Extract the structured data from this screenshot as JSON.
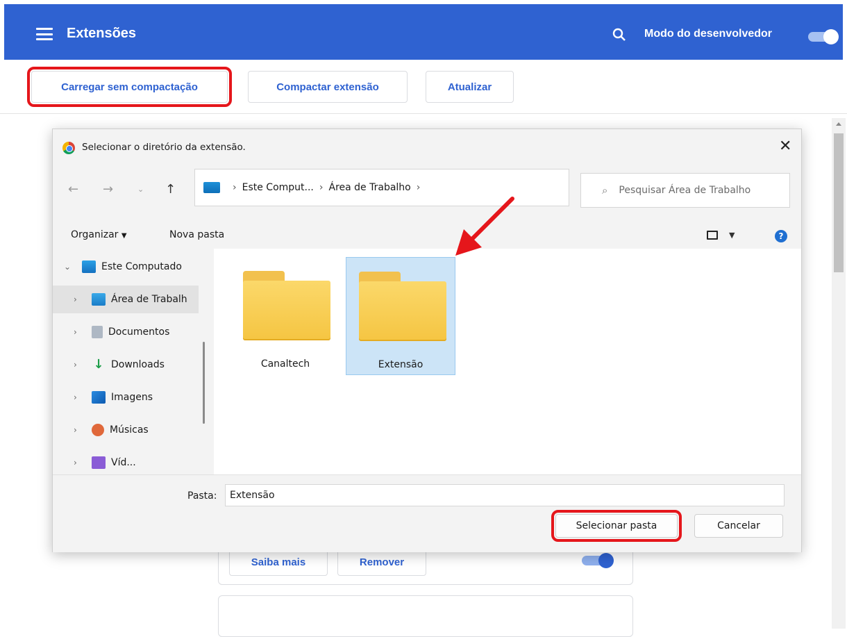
{
  "header": {
    "title": "Extensões",
    "dev_mode_label": "Modo do desenvolvedor",
    "dev_mode_enabled": true
  },
  "toolbar": {
    "load_unpacked": "Carregar sem compactação",
    "pack_extension": "Compactar extensão",
    "update": "Atualizar"
  },
  "background_card": {
    "learn_more": "Saiba mais",
    "remove": "Remover",
    "enabled": true
  },
  "dialog": {
    "title": "Selecionar o diretório da extensão.",
    "breadcrumb": [
      "Este Comput...",
      "Área de Trabalho"
    ],
    "search_placeholder": "Pesquisar Área de Trabalho",
    "organize": "Organizar",
    "new_folder": "Nova pasta",
    "nav_items": [
      {
        "label": "Este Computado",
        "expanded": true,
        "icon": "computer-icon"
      },
      {
        "label": "Área de Trabalh",
        "selected": true,
        "icon": "desktop-icon"
      },
      {
        "label": "Documentos",
        "icon": "documents-icon"
      },
      {
        "label": "Downloads",
        "icon": "download-icon"
      },
      {
        "label": "Imagens",
        "icon": "pictures-icon"
      },
      {
        "label": "Músicas",
        "icon": "music-icon"
      },
      {
        "label": "Víd...",
        "icon": "videos-icon"
      }
    ],
    "folders": [
      {
        "name": "Canaltech",
        "selected": false
      },
      {
        "name": "Extensão",
        "selected": true
      }
    ],
    "folder_field_label": "Pasta:",
    "folder_field_value": "Extensão",
    "select_button": "Selecionar pasta",
    "cancel_button": "Cancelar"
  },
  "colors": {
    "header_blue": "#2f62d1",
    "highlight_red": "#e5161b",
    "selection_blue": "#cce4f7"
  }
}
